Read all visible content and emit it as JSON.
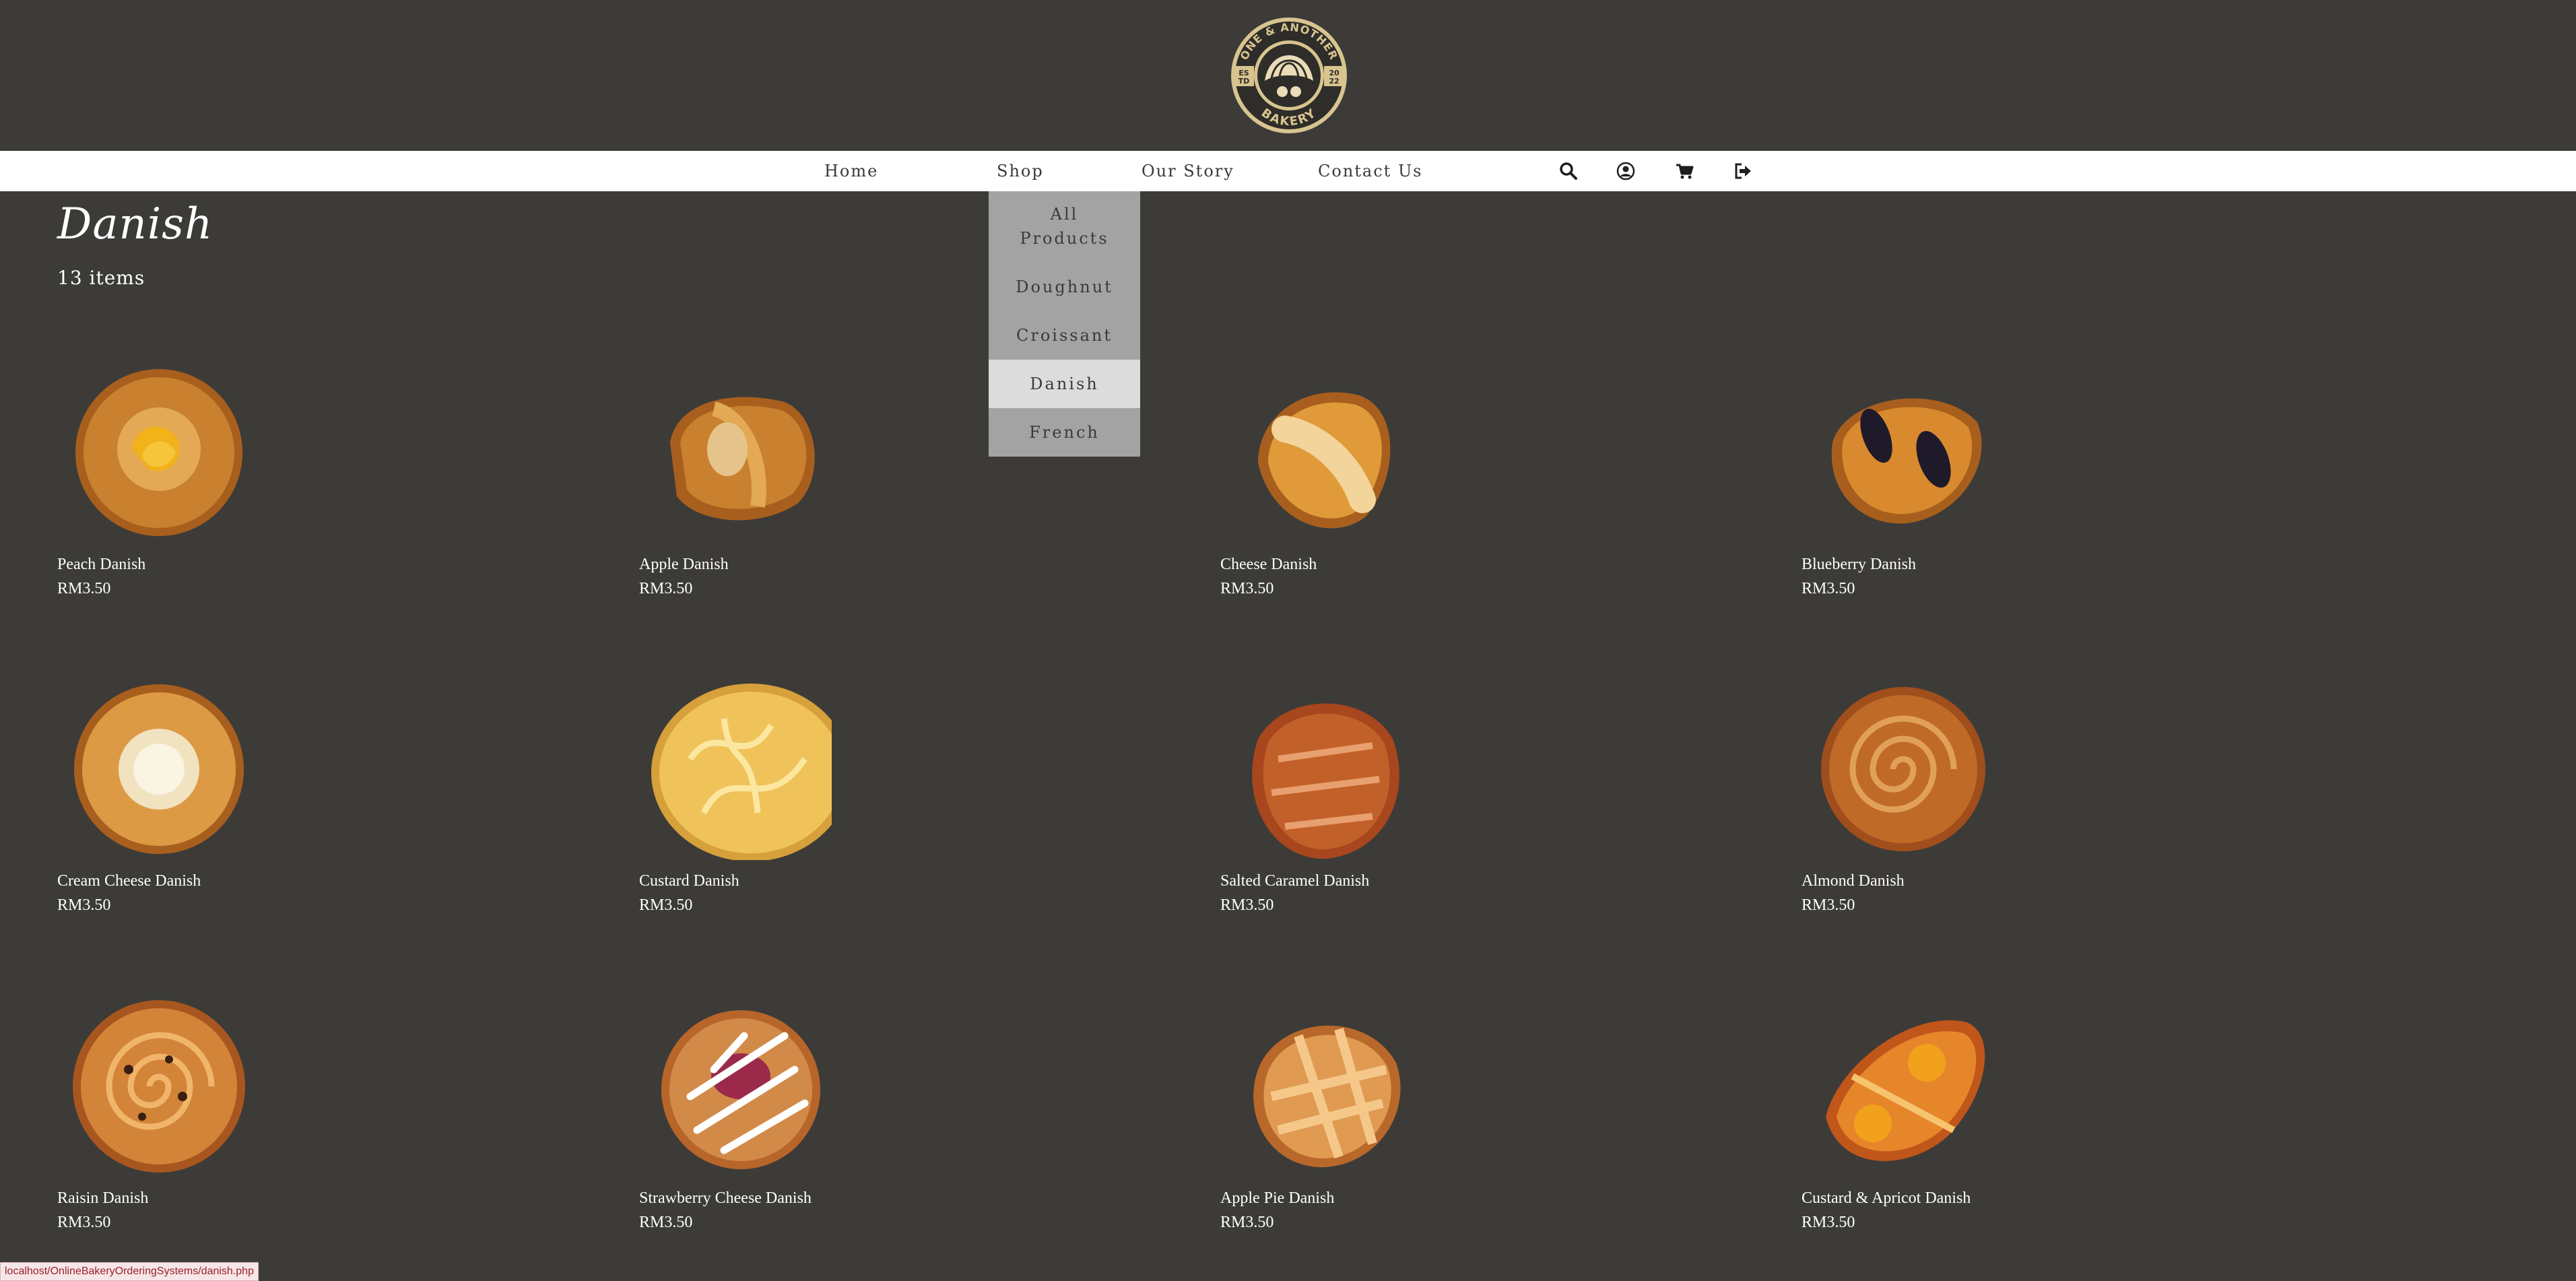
{
  "logo": {
    "arc_top": "ONE & ANOTHER",
    "arc_bottom": "BAKERY",
    "est": "ES TD",
    "year": "20 22"
  },
  "nav": {
    "links": [
      {
        "label": "Home"
      },
      {
        "label": "Shop"
      },
      {
        "label": "Our Story"
      },
      {
        "label": "Contact Us"
      }
    ],
    "icons": [
      "search-icon",
      "account-icon",
      "cart-icon",
      "logout-icon"
    ]
  },
  "shop_menu": {
    "items": [
      {
        "label": "All Products",
        "selected": false
      },
      {
        "label": "Doughnut",
        "selected": false
      },
      {
        "label": "Croissant",
        "selected": false
      },
      {
        "label": "Danish",
        "selected": true
      },
      {
        "label": "French",
        "selected": false
      }
    ]
  },
  "page": {
    "title": "Danish",
    "count": "13 items"
  },
  "products": [
    {
      "name": "Peach Danish",
      "price": "RM3.50",
      "kind": "peach"
    },
    {
      "name": "Apple Danish",
      "price": "RM3.50",
      "kind": "apple"
    },
    {
      "name": "Cheese Danish",
      "price": "RM3.50",
      "kind": "cheese"
    },
    {
      "name": "Blueberry Danish",
      "price": "RM3.50",
      "kind": "blueberry"
    },
    {
      "name": "Cream Cheese Danish",
      "price": "RM3.50",
      "kind": "creamcheese"
    },
    {
      "name": "Custard Danish",
      "price": "RM3.50",
      "kind": "custard"
    },
    {
      "name": "Salted Caramel Danish",
      "price": "RM3.50",
      "kind": "caramel"
    },
    {
      "name": "Almond Danish",
      "price": "RM3.50",
      "kind": "almond"
    },
    {
      "name": "Raisin Danish",
      "price": "RM3.50",
      "kind": "raisin"
    },
    {
      "name": "Strawberry Cheese Danish",
      "price": "RM3.50",
      "kind": "strawberry"
    },
    {
      "name": "Apple Pie Danish",
      "price": "RM3.50",
      "kind": "applepie"
    },
    {
      "name": "Custard & Apricot Danish",
      "price": "RM3.50",
      "kind": "apricot"
    }
  ],
  "status_bar": {
    "url": "localhost/OnlineBakeryOrderingSystems/danish.php"
  },
  "colors": {
    "background": "#3d3b38",
    "navbar": "#ffffff",
    "dropdown": "#a3a3a3",
    "dropdown_active": "#dcdcdc",
    "logo_gold": "#d8c48f"
  }
}
